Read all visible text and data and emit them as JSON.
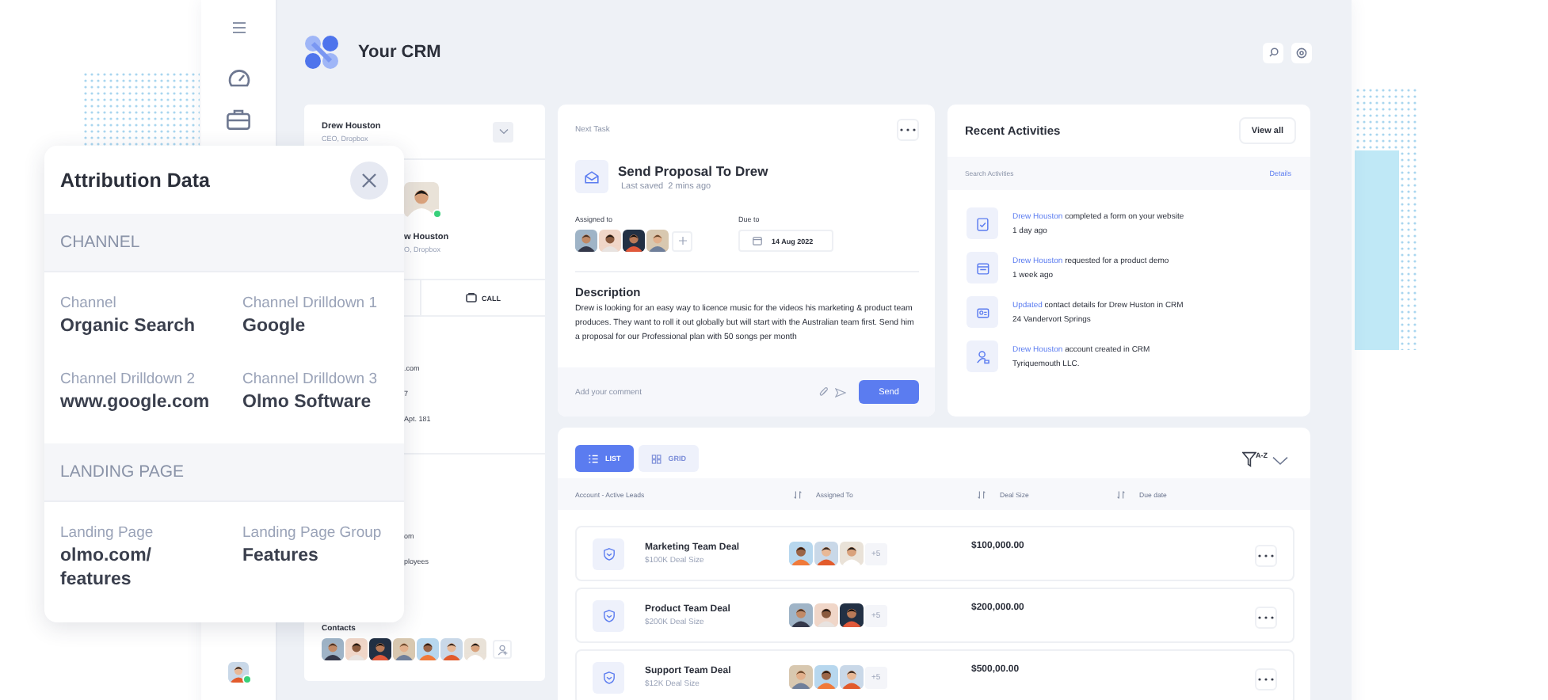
{
  "sidebar": {
    "avatar": {
      "kind": "picture",
      "online": true
    }
  },
  "header": {
    "title": "Your CRM"
  },
  "contact_card": {
    "name": "Drew Houston",
    "role": "CEO, Dropbox",
    "profile": {
      "kind": "picture",
      "online": true
    },
    "profile_name": "w Houston",
    "profile_role": "O, Dropbox",
    "call_label": "CALL",
    "details": [
      ".com",
      "7",
      "Apt. 181"
    ],
    "company_details": [
      "om",
      "ployees"
    ],
    "contacts_label": "Contacts",
    "contacts": [
      {
        "kind": "picture"
      },
      {
        "kind": "picture"
      },
      {
        "kind": "picture"
      },
      {
        "kind": "picture"
      },
      {
        "kind": "picture"
      },
      {
        "kind": "picture"
      },
      {
        "kind": "picture"
      }
    ]
  },
  "next_task": {
    "label": "Next Task",
    "title": "Send Proposal To Drew",
    "saved": "Last saved  2 mins ago",
    "assigned_label": "Assigned to",
    "assignees": [
      {
        "kind": "picture"
      },
      {
        "kind": "picture"
      },
      {
        "kind": "picture"
      },
      {
        "kind": "picture"
      }
    ],
    "due_label": "Due to",
    "due_date": "14 Aug 2022",
    "description_title": "Description",
    "description": "Drew is looking for an easy way to licence music for the videos his marketing & product team produces. They want to roll it out globally but will start with the Australian team first. Send him a proposal for our Professional plan with 50 songs per month",
    "comment": {
      "placeholder": "Add your comment"
    },
    "send_label": "Send"
  },
  "activities": {
    "title": "Recent Activities",
    "view_all": "View all",
    "search_label": "Search Activities",
    "details_link": "Details",
    "items": [
      {
        "kind": "form",
        "actor": "Drew Houston",
        "text": "completed a form on your website",
        "meta": "1 day ago"
      },
      {
        "kind": "calendar",
        "actor": "Drew Houston",
        "text": "requested for a product demo",
        "meta": "1 week ago"
      },
      {
        "kind": "contact",
        "actor": "Updated",
        "text": "contact details for Drew Huston in CRM",
        "meta": "24 Vandervort Springs"
      },
      {
        "kind": "user",
        "actor": "Drew Houston",
        "text": "account created in CRM",
        "meta": "Tyriquemouth LLC."
      }
    ]
  },
  "deals": {
    "views": [
      {
        "kind": "list",
        "label": "LIST",
        "selected": true
      },
      {
        "kind": "grid",
        "label": "GRID",
        "selected": false
      }
    ],
    "sort_label": "A-Z",
    "columns": [
      {
        "label": "Account - Active Leads",
        "sortable": true
      },
      {
        "label": "Assigned To",
        "sortable": true
      },
      {
        "label": "Deal Size",
        "sortable": true
      },
      {
        "label": "Due date",
        "sortable": false
      }
    ],
    "rows": [
      {
        "name": "Marketing Team Deal",
        "subtitle": "$100K Deal Size",
        "assignees": [
          {
            "kind": "picture"
          },
          {
            "kind": "picture"
          },
          {
            "kind": "picture"
          }
        ],
        "more_count": "+5",
        "deal_size": "$100,000.00"
      },
      {
        "name": "Product Team Deal",
        "subtitle": "$200K Deal Size",
        "assignees": [
          {
            "kind": "picture"
          },
          {
            "kind": "picture"
          },
          {
            "kind": "picture"
          }
        ],
        "more_count": "+5",
        "deal_size": "$200,000.00"
      },
      {
        "name": "Support Team Deal",
        "subtitle": "$12K Deal Size",
        "assignees": [
          {
            "kind": "picture"
          },
          {
            "kind": "picture"
          },
          {
            "kind": "picture"
          }
        ],
        "more_count": "+5",
        "deal_size": "$500,00.00"
      }
    ]
  },
  "attribution": {
    "title": "Attribution Data",
    "sections": [
      {
        "title": "CHANNEL",
        "fields": [
          {
            "label": "Channel",
            "value": "Organic Search"
          },
          {
            "label": "Channel Drilldown 1",
            "value": "Google"
          },
          {
            "label": "Channel Drilldown 2",
            "value": "www.google.com"
          },
          {
            "label": "Channel Drilldown 3",
            "value": "Olmo Software"
          }
        ]
      },
      {
        "title": "LANDING PAGE",
        "fields": [
          {
            "label": "Landing Page",
            "value": "olmo.com/ features"
          },
          {
            "label": "Landing Page Group",
            "value": "Features"
          }
        ]
      }
    ]
  }
}
